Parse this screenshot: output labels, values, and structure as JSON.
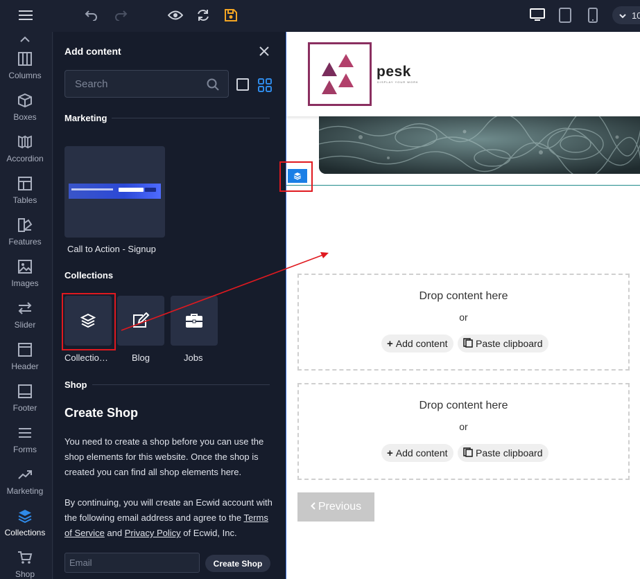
{
  "topbar": {
    "icons": [
      "menu-icon",
      "undo-icon",
      "redo-icon",
      "preview-eye-icon",
      "refresh-icon",
      "save-icon",
      "desktop-icon",
      "tablet-icon",
      "mobile-icon",
      "chevron-down-icon"
    ],
    "zoom_label": "10",
    "accent_save": "#f5a623"
  },
  "rail": {
    "items": [
      {
        "label": "Columns",
        "icon": "columns-icon"
      },
      {
        "label": "Boxes",
        "icon": "box-icon"
      },
      {
        "label": "Accordion",
        "icon": "accordion-icon"
      },
      {
        "label": "Tables",
        "icon": "table-icon"
      },
      {
        "label": "Features",
        "icon": "features-icon"
      },
      {
        "label": "Images",
        "icon": "image-icon"
      },
      {
        "label": "Slider",
        "icon": "slider-icon"
      },
      {
        "label": "Header",
        "icon": "header-icon"
      },
      {
        "label": "Footer",
        "icon": "footer-icon"
      },
      {
        "label": "Forms",
        "icon": "forms-icon"
      },
      {
        "label": "Marketing",
        "icon": "trend-icon"
      },
      {
        "label": "Collections",
        "icon": "layers-icon",
        "active": true
      },
      {
        "label": "Shop",
        "icon": "cart-icon"
      }
    ],
    "active_color": "#2f8ae8"
  },
  "panel": {
    "title": "Add content",
    "search_placeholder": "Search",
    "sections": {
      "marketing": "Marketing",
      "collections": "Collections",
      "shop": "Shop"
    },
    "cta_label": "Call to Action - Signup",
    "collection_items": [
      {
        "label": "Collectio…",
        "icon": "layers-icon"
      },
      {
        "label": "Blog",
        "icon": "edit-icon"
      },
      {
        "label": "Jobs",
        "icon": "briefcase-icon"
      }
    ],
    "shop_title": "Create Shop",
    "shop_desc": "You need to create a shop before you can use the shop elements for this website. Once the shop is created you can find all shop elements here.",
    "shop_desc2_pre": "By continuing, you will create an Ecwid account with the following email address and agree to the ",
    "shop_tos": "Terms of Service",
    "shop_and": " and ",
    "shop_privacy": "Privacy Policy",
    "shop_desc2_post": " of Ecwid, Inc.",
    "email_placeholder": "Email",
    "create_button": "Create Shop"
  },
  "canvas": {
    "logo_text": "pesk",
    "logo_sub": "DISPLAY YOUR WORK",
    "drop_zones": [
      {
        "title": "Drop content here",
        "or": "or",
        "add": "Add content",
        "paste": "Paste clipboard"
      },
      {
        "title": "Drop content here",
        "or": "or",
        "add": "Add content",
        "paste": "Paste clipboard"
      }
    ],
    "previous_label": "Previous"
  }
}
